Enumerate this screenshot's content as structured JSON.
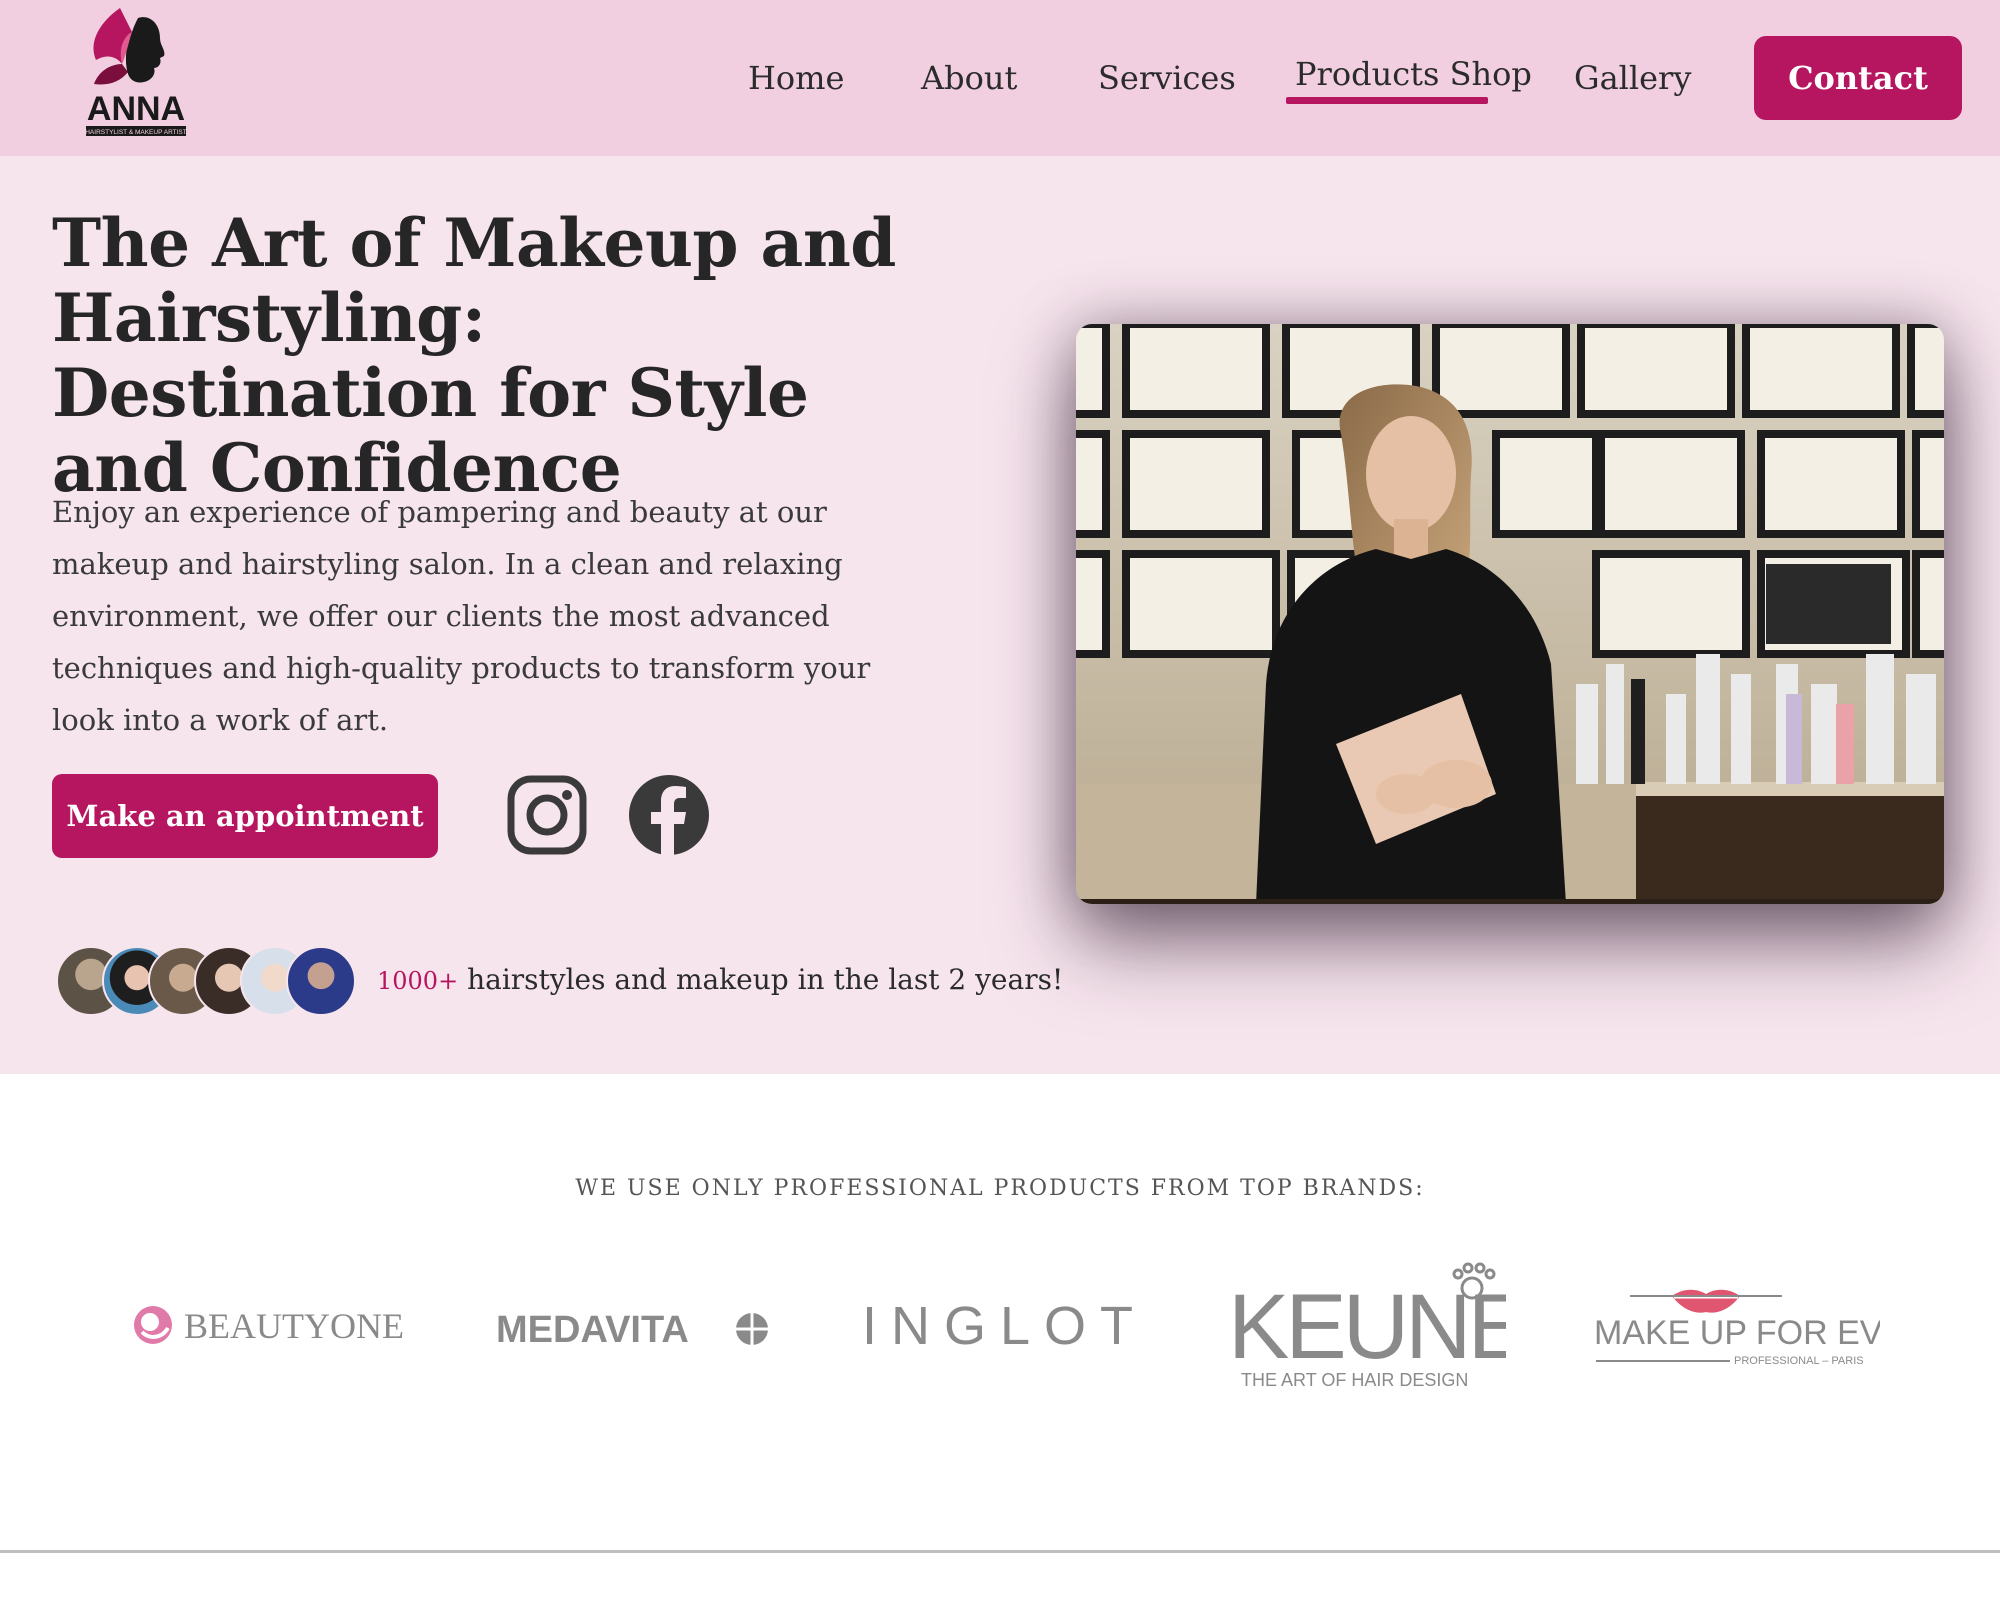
{
  "header": {
    "logo_text": "ANNA",
    "logo_subtext": "HAIRSTYLIST & MAKEUP ARTIST",
    "nav": [
      {
        "label": "Home"
      },
      {
        "label": "About"
      },
      {
        "label": "Services"
      },
      {
        "label": "Products Shop",
        "active": true
      },
      {
        "label": "Gallery"
      }
    ],
    "contact_label": "Contact"
  },
  "hero": {
    "title": "The Art of Makeup and Hairstyling: Destination for Style and Confidence",
    "description": "Enjoy an experience of pampering and beauty at our makeup and hairstyling salon. In a clean and relaxing environment, we offer our clients the most advanced techniques and high-quality products to transform your look into a work of art.",
    "appointment_label": "Make an appointment",
    "social_icons": [
      "instagram-icon",
      "facebook-icon"
    ],
    "stat_number": "1000+",
    "stat_text": " hairstyles and makeup in the last 2 years!",
    "avatar_count": 6
  },
  "brands": {
    "heading": "WE USE ONLY PROFESSIONAL PRODUCTS FROM TOP BRANDS:",
    "items": [
      {
        "name": "BEAUTYONE"
      },
      {
        "name": "MEDAVITA"
      },
      {
        "name": "INGLOT"
      },
      {
        "name": "KEUNE",
        "tagline": "THE ART OF HAIR DESIGN"
      },
      {
        "name": "MAKE UP FOR EVER",
        "tagline": "PROFESSIONAL – PARIS"
      }
    ]
  },
  "colors": {
    "accent": "#b6165f",
    "header_bg": "#f2cfe0",
    "hero_bg": "#f7e5ee",
    "text": "#2b2b2b",
    "brand_gray": "#8a8a8a"
  }
}
